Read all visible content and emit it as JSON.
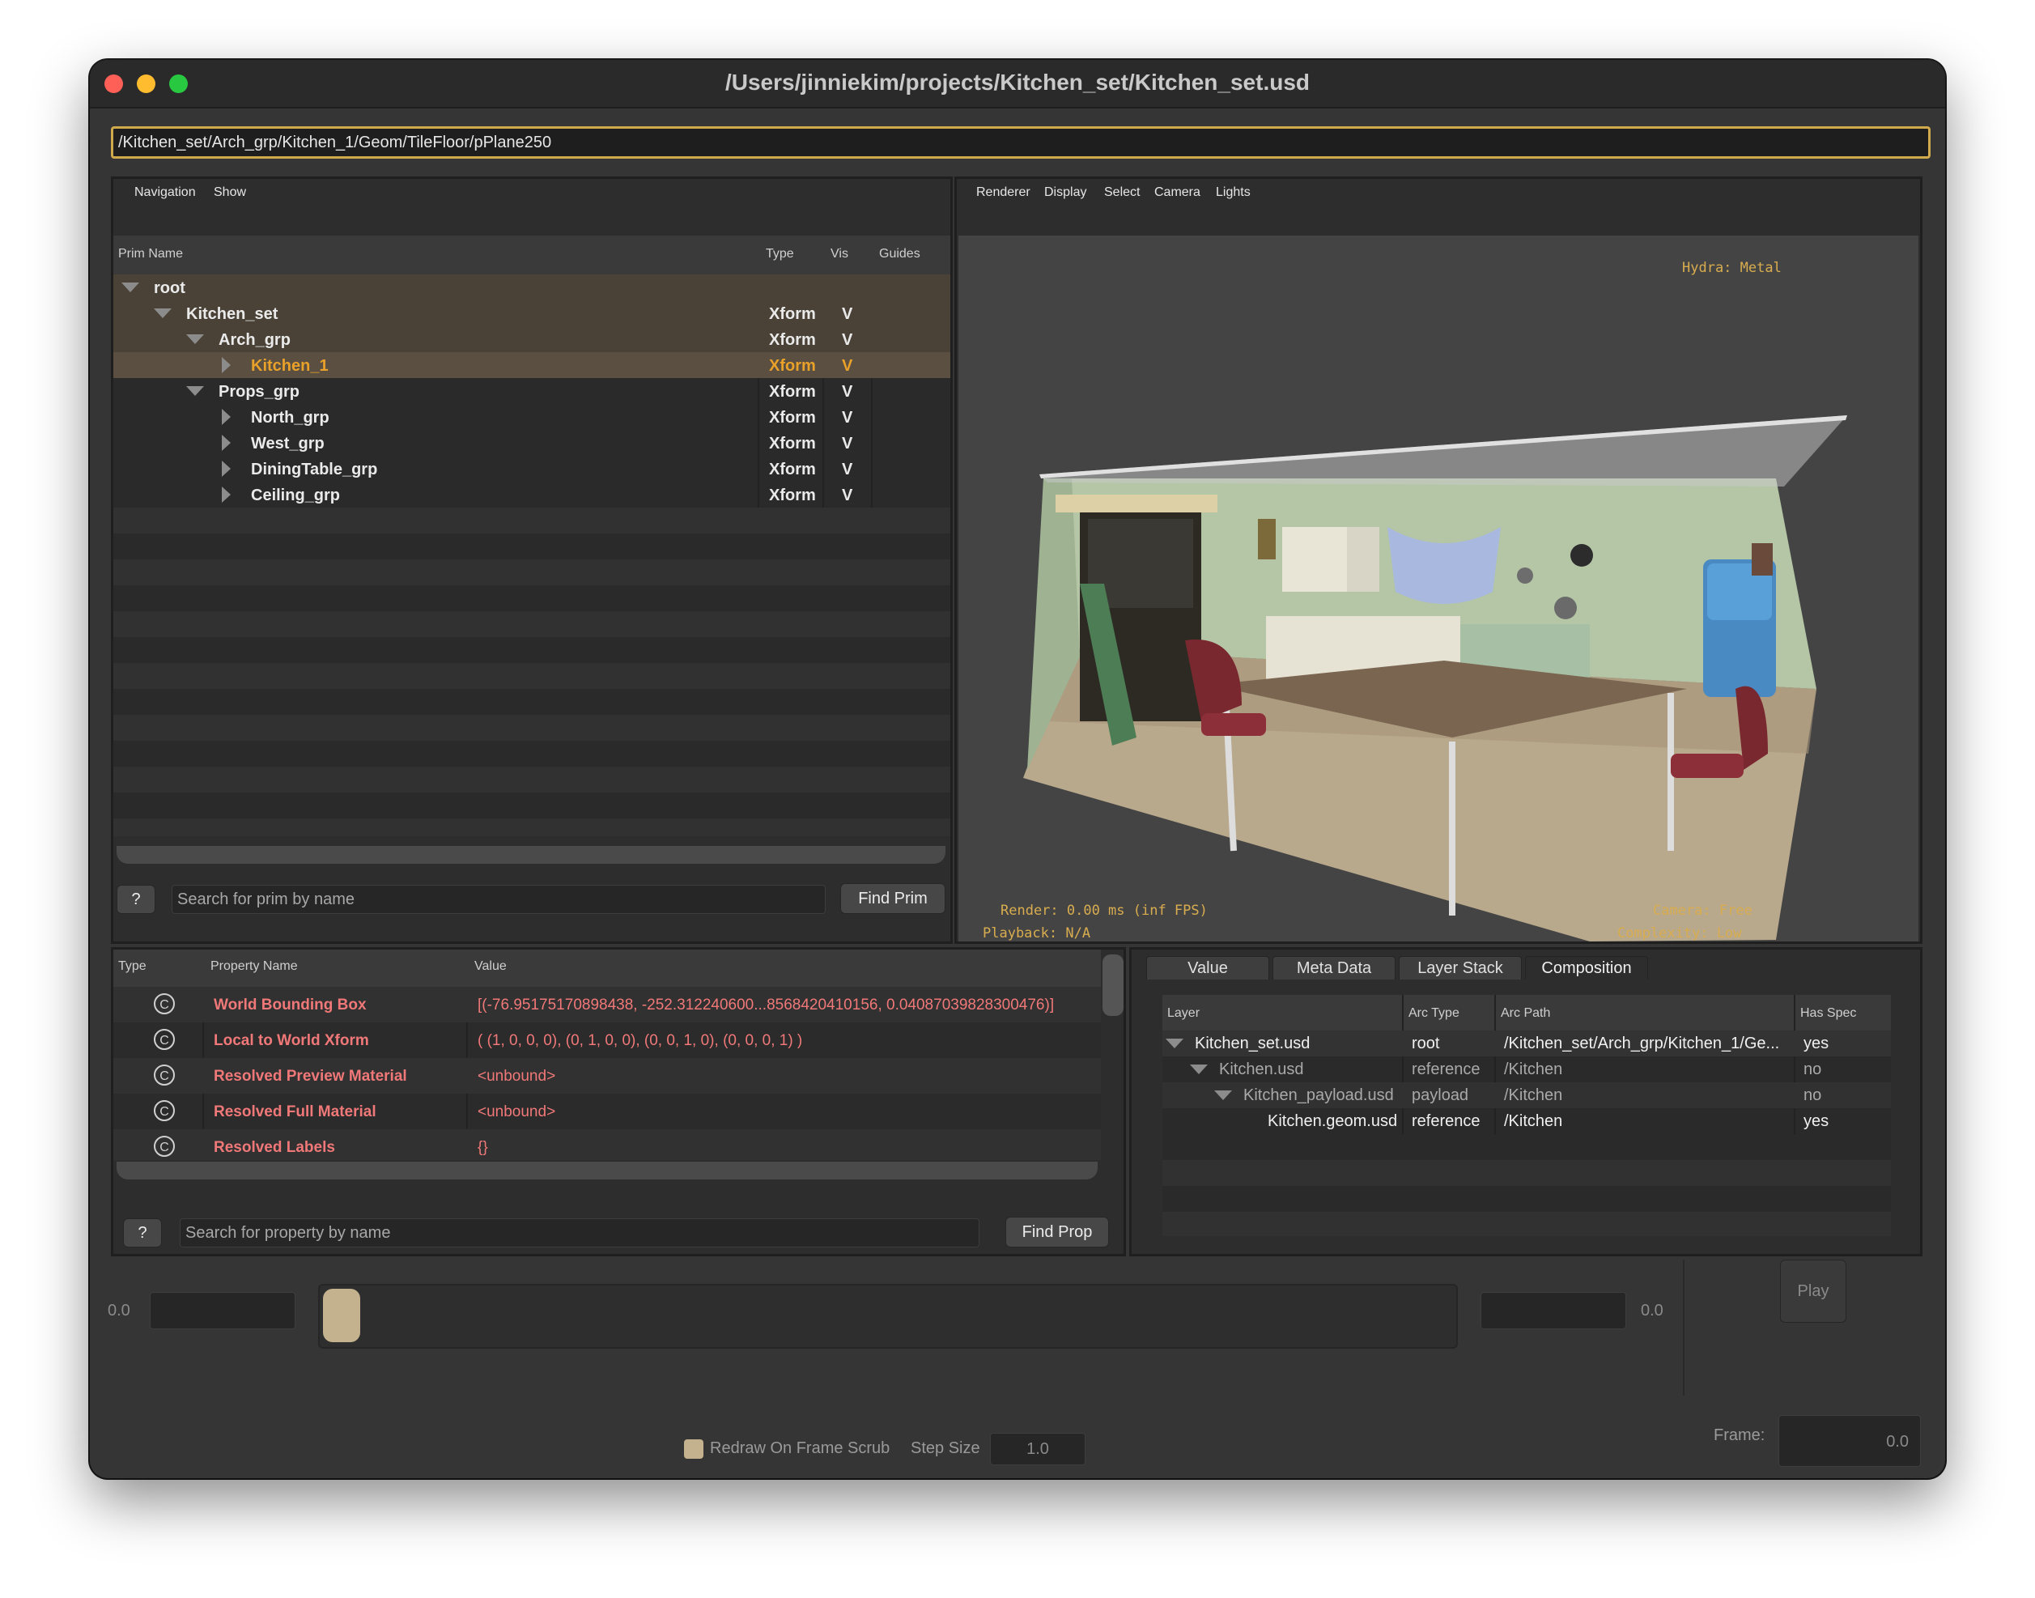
{
  "window": {
    "title": "/Users/jinniekim/projects/Kitchen_set/Kitchen_set.usd"
  },
  "path_field": {
    "value": "/Kitchen_set/Arch_grp/Kitchen_1/Geom/TileFloor/pPlane250"
  },
  "prim_panel": {
    "menus": [
      "Navigation",
      "Show"
    ],
    "columns": {
      "name": "Prim Name",
      "type": "Type",
      "vis": "Vis",
      "guides": "Guides"
    },
    "rows": [
      {
        "name": "root",
        "type": "",
        "vis": "",
        "expanded": true,
        "selected": false
      },
      {
        "name": "Kitchen_set",
        "type": "Xform",
        "vis": "V",
        "expanded": true,
        "selected": false
      },
      {
        "name": "Arch_grp",
        "type": "Xform",
        "vis": "V",
        "expanded": true,
        "selected": false
      },
      {
        "name": "Kitchen_1",
        "type": "Xform",
        "vis": "V",
        "expanded": false,
        "selected": true
      },
      {
        "name": "Props_grp",
        "type": "Xform",
        "vis": "V",
        "expanded": true,
        "selected": false
      },
      {
        "name": "North_grp",
        "type": "Xform",
        "vis": "V",
        "expanded": false,
        "selected": false
      },
      {
        "name": "West_grp",
        "type": "Xform",
        "vis": "V",
        "expanded": false,
        "selected": false
      },
      {
        "name": "DiningTable_grp",
        "type": "Xform",
        "vis": "V",
        "expanded": false,
        "selected": false
      },
      {
        "name": "Ceiling_grp",
        "type": "Xform",
        "vis": "V",
        "expanded": false,
        "selected": false
      }
    ],
    "help_label": "?",
    "search_placeholder": "Search for prim by name",
    "find_label": "Find Prim"
  },
  "viewport": {
    "menus": [
      "Renderer",
      "Display",
      "Select",
      "Camera",
      "Lights"
    ],
    "hud_renderer": "Hydra: Metal",
    "hud_render": "Render: 0.00 ms (inf FPS)",
    "hud_playback": "Playback: N/A",
    "hud_camera": "Camera: Free",
    "hud_complexity": "Complexity: Low"
  },
  "property_panel": {
    "columns": {
      "type": "Type",
      "name": "Property Name",
      "value": "Value"
    },
    "rows": [
      {
        "type_icon": "C",
        "name": "World Bounding Box",
        "value": "[(-76.95175170898438, -252.312240600...8568420410156, 0.04087039828300476)]"
      },
      {
        "type_icon": "C",
        "name": "Local to World Xform",
        "value": "( (1, 0, 0, 0), (0, 1, 0, 0), (0, 0, 1, 0), (0, 0, 0, 1) )"
      },
      {
        "type_icon": "C",
        "name": "Resolved Preview Material",
        "value": "<unbound>"
      },
      {
        "type_icon": "C",
        "name": "Resolved Full Material",
        "value": "<unbound>"
      },
      {
        "type_icon": "C",
        "name": "Resolved Labels",
        "value": "{}"
      }
    ],
    "help_label": "?",
    "search_placeholder": "Search for property by name",
    "find_label": "Find Prop"
  },
  "composition_panel": {
    "tabs": [
      "Value",
      "Meta Data",
      "Layer Stack",
      "Composition"
    ],
    "active_tab": "Composition",
    "columns": {
      "layer": "Layer",
      "arc_type": "Arc Type",
      "arc_path": "Arc Path",
      "has_spec": "Has Spec"
    },
    "rows": [
      {
        "layer": "Kitchen_set.usd",
        "arc_type": "root",
        "arc_path": "/Kitchen_set/Arch_grp/Kitchen_1/Ge...",
        "has_spec": "yes"
      },
      {
        "layer": "Kitchen.usd",
        "arc_type": "reference",
        "arc_path": "/Kitchen",
        "has_spec": "no"
      },
      {
        "layer": "Kitchen_payload.usd",
        "arc_type": "payload",
        "arc_path": "/Kitchen",
        "has_spec": "no"
      },
      {
        "layer": "Kitchen.geom.usd",
        "arc_type": "reference",
        "arc_path": "/Kitchen",
        "has_spec": "yes"
      }
    ]
  },
  "timeline": {
    "start_value": "0.0",
    "end_value": "0.0",
    "play_label": "Play",
    "redraw_label": "Redraw On Frame Scrub",
    "step_size_label": "Step Size",
    "step_size_value": "1.0",
    "frame_label": "Frame:",
    "frame_value": "0.0"
  },
  "colors": {
    "accent": "#d1a94d",
    "selected_text": "#e9a12a",
    "property_text": "#f07878",
    "window_bg": "#353535"
  }
}
